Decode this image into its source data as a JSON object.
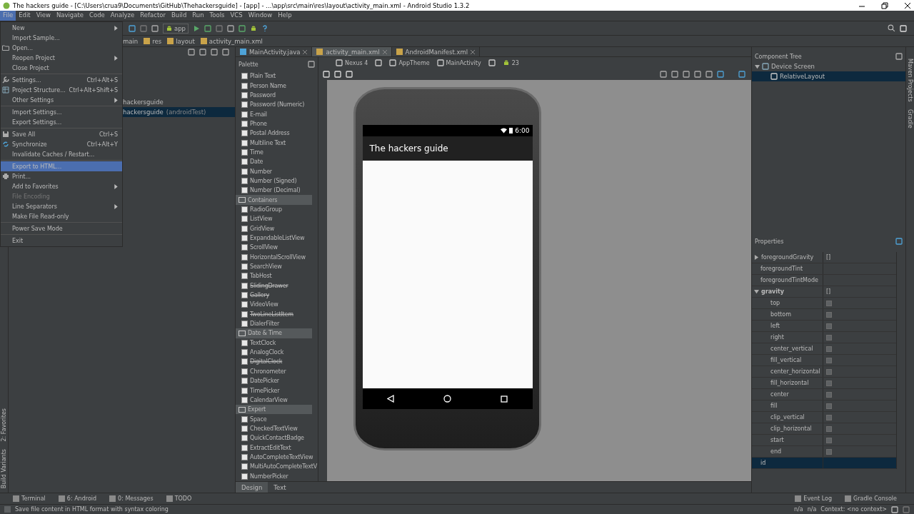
{
  "window": {
    "title": "The hackers guide - [C:\\Users\\crua9\\Documents\\GitHub\\Thehackersguide] - [app] - ...\\app\\src\\main\\res\\layout\\activity_main.xml - Android Studio 1.3.2"
  },
  "menubar": [
    {
      "label": "File",
      "selected": true
    },
    {
      "label": "Edit",
      "selected": false
    },
    {
      "label": "View",
      "selected": false
    },
    {
      "label": "Navigate",
      "selected": false
    },
    {
      "label": "Code",
      "selected": false
    },
    {
      "label": "Analyze",
      "selected": false
    },
    {
      "label": "Refactor",
      "selected": false
    },
    {
      "label": "Build",
      "selected": false
    },
    {
      "label": "Run",
      "selected": false
    },
    {
      "label": "Tools",
      "selected": false
    },
    {
      "label": "VCS",
      "selected": false
    },
    {
      "label": "Window",
      "selected": false
    },
    {
      "label": "Help",
      "selected": false
    }
  ],
  "file_menu": [
    {
      "kind": "item",
      "label": "New",
      "submenu": true,
      "selected": false,
      "disabled": false
    },
    {
      "kind": "item",
      "label": "Import Sample...",
      "selected": false,
      "disabled": false
    },
    {
      "kind": "item",
      "label": "Open...",
      "selected": false,
      "disabled": false
    },
    {
      "kind": "item",
      "label": "Reopen Project",
      "submenu": true,
      "selected": false,
      "disabled": false
    },
    {
      "kind": "item",
      "label": "Close Project",
      "selected": false,
      "disabled": false
    },
    {
      "kind": "separator"
    },
    {
      "kind": "item",
      "label": "Settings...",
      "shortcut": "Ctrl+Alt+S",
      "selected": false,
      "disabled": false
    },
    {
      "kind": "item",
      "label": "Project Structure...",
      "shortcut": "Ctrl+Alt+Shift+S",
      "selected": false,
      "disabled": false
    },
    {
      "kind": "item",
      "label": "Other Settings",
      "submenu": true,
      "selected": false,
      "disabled": false
    },
    {
      "kind": "separator"
    },
    {
      "kind": "item",
      "label": "Import Settings...",
      "selected": false,
      "disabled": false
    },
    {
      "kind": "item",
      "label": "Export Settings...",
      "selected": false,
      "disabled": false
    },
    {
      "kind": "separator"
    },
    {
      "kind": "item",
      "label": "Save All",
      "shortcut": "Ctrl+S",
      "selected": false,
      "disabled": false
    },
    {
      "kind": "item",
      "label": "Synchronize",
      "shortcut": "Ctrl+Alt+Y",
      "selected": false,
      "disabled": false
    },
    {
      "kind": "item",
      "label": "Invalidate Caches / Restart...",
      "selected": false,
      "disabled": false
    },
    {
      "kind": "separator"
    },
    {
      "kind": "item",
      "label": "Export to HTML...",
      "selected": true,
      "disabled": false
    },
    {
      "kind": "item",
      "label": "Print...",
      "selected": false,
      "disabled": false
    },
    {
      "kind": "item",
      "label": "Add to Favorites",
      "submenu": true,
      "selected": false,
      "disabled": false
    },
    {
      "kind": "item",
      "label": "File Encoding",
      "selected": false,
      "disabled": true
    },
    {
      "kind": "item",
      "label": "Line Separators",
      "submenu": true,
      "selected": false,
      "disabled": false
    },
    {
      "kind": "item",
      "label": "Make File Read-only",
      "selected": false,
      "disabled": false
    },
    {
      "kind": "separator"
    },
    {
      "kind": "item",
      "label": "Power Save Mode",
      "selected": false,
      "disabled": false
    },
    {
      "kind": "separator"
    },
    {
      "kind": "item",
      "label": "Exit",
      "selected": false,
      "disabled": false
    }
  ],
  "toolbar": {
    "run_config": "app"
  },
  "breadcrumbs": [
    "main",
    "res",
    "layout",
    "activity_main.xml"
  ],
  "project_tree": [
    {
      "label": "hackersguide",
      "selected": false
    },
    {
      "label": "hackersguide",
      "note": "(androidTest)",
      "selected": true
    }
  ],
  "editor_tabs": [
    {
      "label": "MainActivity.java",
      "selected": false
    },
    {
      "label": "activity_main.xml",
      "selected": true
    },
    {
      "label": "AndroidManifest.xml",
      "selected": false
    }
  ],
  "palette": {
    "title": "Palette",
    "items": [
      {
        "kind": "item",
        "label": "Plain Text"
      },
      {
        "kind": "item",
        "label": "Person Name"
      },
      {
        "kind": "item",
        "label": "Password"
      },
      {
        "kind": "item",
        "label": "Password (Numeric)"
      },
      {
        "kind": "item",
        "label": "E-mail"
      },
      {
        "kind": "item",
        "label": "Phone"
      },
      {
        "kind": "item",
        "label": "Postal Address"
      },
      {
        "kind": "item",
        "label": "Multiline Text"
      },
      {
        "kind": "item",
        "label": "Time"
      },
      {
        "kind": "item",
        "label": "Date"
      },
      {
        "kind": "item",
        "label": "Number"
      },
      {
        "kind": "item",
        "label": "Number (Signed)"
      },
      {
        "kind": "item",
        "label": "Number (Decimal)"
      },
      {
        "kind": "group",
        "label": "Containers"
      },
      {
        "kind": "item",
        "label": "RadioGroup"
      },
      {
        "kind": "item",
        "label": "ListView"
      },
      {
        "kind": "item",
        "label": "GridView"
      },
      {
        "kind": "item",
        "label": "ExpandableListView"
      },
      {
        "kind": "item",
        "label": "ScrollView"
      },
      {
        "kind": "item",
        "label": "HorizontalScrollView"
      },
      {
        "kind": "item",
        "label": "SearchView"
      },
      {
        "kind": "item",
        "label": "TabHost"
      },
      {
        "kind": "item",
        "label": "SlidingDrawer",
        "deprecated": true
      },
      {
        "kind": "item",
        "label": "Gallery",
        "deprecated": true
      },
      {
        "kind": "item",
        "label": "VideoView"
      },
      {
        "kind": "item",
        "label": "TwoLineListItem",
        "deprecated": true
      },
      {
        "kind": "item",
        "label": "DialerFilter"
      },
      {
        "kind": "group",
        "label": "Date & Time"
      },
      {
        "kind": "item",
        "label": "TextClock"
      },
      {
        "kind": "item",
        "label": "AnalogClock"
      },
      {
        "kind": "item",
        "label": "DigitalClock",
        "deprecated": true
      },
      {
        "kind": "item",
        "label": "Chronometer"
      },
      {
        "kind": "item",
        "label": "DatePicker"
      },
      {
        "kind": "item",
        "label": "TimePicker"
      },
      {
        "kind": "item",
        "label": "CalendarView"
      },
      {
        "kind": "group",
        "label": "Expert"
      },
      {
        "kind": "item",
        "label": "Space"
      },
      {
        "kind": "item",
        "label": "CheckedTextView"
      },
      {
        "kind": "item",
        "label": "QuickContactBadge"
      },
      {
        "kind": "item",
        "label": "ExtractEditText"
      },
      {
        "kind": "item",
        "label": "AutoCompleteTextView"
      },
      {
        "kind": "item",
        "label": "MultiAutoCompleteTextV"
      },
      {
        "kind": "item",
        "label": "NumberPicker"
      }
    ]
  },
  "designer": {
    "device": "Nexus 4",
    "theme": "AppTheme",
    "activity": "MainActivity",
    "api": "23"
  },
  "preview": {
    "time": "6:00",
    "app_title": "The hackers guide"
  },
  "editor_mode_tabs": [
    {
      "label": "Design",
      "selected": true
    },
    {
      "label": "Text",
      "selected": false
    }
  ],
  "component_tree": {
    "title": "Component Tree",
    "items": [
      {
        "label": "Device Screen",
        "expanded": true,
        "selected": false,
        "children": [
          {
            "label": "RelativeLayout",
            "selected": true
          }
        ]
      }
    ]
  },
  "properties": {
    "title": "Properties",
    "rows": [
      {
        "name": "foregroundGravity",
        "value": "[]",
        "expanded": false,
        "selected": false
      },
      {
        "name": "foregroundTint",
        "selected": false
      },
      {
        "name": "foregroundTintMode",
        "selected": false
      },
      {
        "name": "gravity",
        "value": "[]",
        "expanded": true,
        "selected": false,
        "children": [
          {
            "name": "top",
            "checked": false
          },
          {
            "name": "bottom",
            "checked": false
          },
          {
            "name": "left",
            "checked": false
          },
          {
            "name": "right",
            "checked": false
          },
          {
            "name": "center_vertical",
            "checked": false
          },
          {
            "name": "fill_vertical",
            "checked": false
          },
          {
            "name": "center_horizontal",
            "checked": false
          },
          {
            "name": "fill_horizontal",
            "checked": false
          },
          {
            "name": "center",
            "checked": false
          },
          {
            "name": "fill",
            "checked": false
          },
          {
            "name": "clip_vertical",
            "checked": false
          },
          {
            "name": "clip_horizontal",
            "checked": false
          },
          {
            "name": "start",
            "checked": false
          },
          {
            "name": "end",
            "checked": false
          }
        ]
      },
      {
        "name": "id",
        "selected": true
      }
    ]
  },
  "left_strip": [
    "2: Favorites",
    "Build Variants"
  ],
  "right_strip": [
    "Maven Projects",
    "Gradle"
  ],
  "tool_windows_left": [
    "Terminal",
    "6: Android",
    "0: Messages",
    "TODO"
  ],
  "tool_windows_right": [
    "Event Log",
    "Gradle Console"
  ],
  "status_bar": {
    "message": "Save file content in HTML format with syntax coloring",
    "items": [
      "n/a",
      "n/a",
      "Context: <no context>"
    ]
  }
}
